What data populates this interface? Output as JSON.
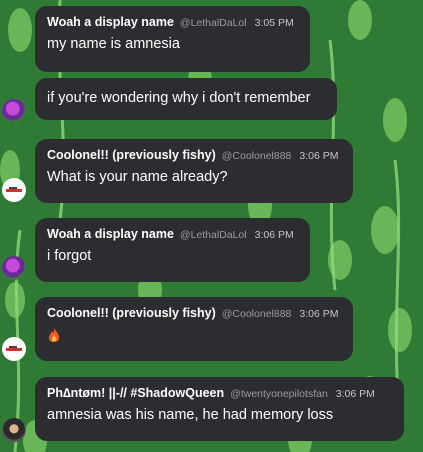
{
  "messages": [
    {
      "name": "Woah a display name",
      "handle": "@LethalDaLol",
      "time": "3:05 PM",
      "text": "my name is amnesia"
    },
    {
      "text": "if you're wondering why i don't remember"
    },
    {
      "name": "Coolonel!! (previously fishy)",
      "handle": "@Coolonel888",
      "time": "3:06 PM",
      "text": "What is your name already?"
    },
    {
      "name": "Woah a display name",
      "handle": "@LethalDaLol",
      "time": "3:06 PM",
      "text": "i forgot"
    },
    {
      "name": "Coolonel!! (previously fishy)",
      "handle": "@Coolonel888",
      "time": "3:06 PM",
      "emoji": "fire-emoji"
    },
    {
      "name": "Ph∆ntøm! ||-// #ShadowQueen",
      "handle": "@twentyonepilotsfan",
      "time": "3:06 PM",
      "text": "amnesia was his name, he had memory loss"
    }
  ],
  "colors": {
    "bubble": "#2b2d31",
    "background": "#2f7a34",
    "leaf": "#7fc86a"
  }
}
